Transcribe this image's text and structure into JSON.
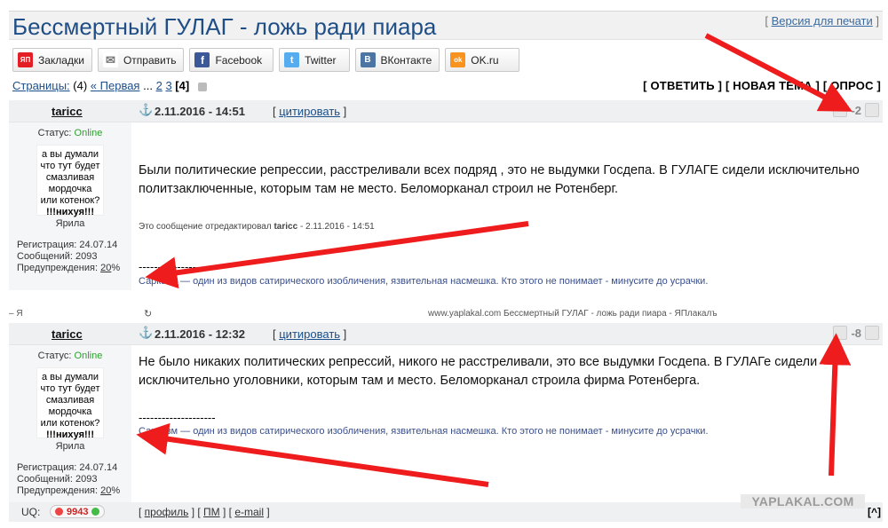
{
  "page": {
    "title": "Бессмертный ГУЛАГ - ложь ради пиара",
    "print_prefix": "[",
    "print_link": "Версия для печати",
    "print_suffix": "]"
  },
  "share": [
    {
      "label": "Закладки",
      "icon": "yandex-icon",
      "color": "#e31e24",
      "glyph": "ЯП"
    },
    {
      "label": "Отправить",
      "icon": "mail-icon",
      "color": "#999999",
      "glyph": "✉"
    },
    {
      "label": "Facebook",
      "icon": "facebook-icon",
      "color": "#3b5998",
      "glyph": "f"
    },
    {
      "label": "Twitter",
      "icon": "twitter-icon",
      "color": "#55acee",
      "glyph": "t"
    },
    {
      "label": "ВКонтакте",
      "icon": "vk-icon",
      "color": "#4c75a3",
      "glyph": "В"
    },
    {
      "label": "OK.ru",
      "icon": "odnoklassniki-icon",
      "color": "#f7931e",
      "glyph": "ok"
    }
  ],
  "pagination": {
    "label": "Страницы:",
    "count": "(4)",
    "first": "« Первая",
    "ellipsis": "...",
    "p2": "2",
    "p3": "3",
    "current": "[4]"
  },
  "actions": {
    "reply": "[ ОТВЕТИТЬ ]",
    "new_topic": "[ НОВАЯ ТЕМА ]",
    "poll": "[ ОПРОС ]"
  },
  "post1": {
    "username": "taricc",
    "date": "2.11.2016 - 14:51",
    "quote": "цитировать",
    "rating": "-2",
    "status_label": "Статус:",
    "status_value": "Online",
    "avatar_lines": [
      "а вы думали",
      "что тут будет",
      "смазливая",
      "мордочка",
      "или котенок?",
      "!!!нихуя!!!"
    ],
    "avatar_caption": "Ярила",
    "reg": "Регистрация: 24.07.14",
    "posts": "Сообщений: 2093",
    "warn_label": "Предупреждения:",
    "warn_value": "20",
    "warn_unit": "%",
    "text": "Были политические репрессии, расстреливали всех подряд , это не выдумки Госдепа. В ГУЛАГЕ сидели исключительно политзаключенные, которым там не место. Беломорканал строил не Ротенберг.",
    "edited_prefix": "Это сообщение отредактировал",
    "edited_user": "taricc",
    "edited_date": "- 2.11.2016 - 14:51",
    "dashes": "--------------------",
    "signature": "Сарказм — один из видов сатирического изобличения, язвительная насмешка. Кто этого не понимает - минусите до усрачки."
  },
  "browser": {
    "left": "–   Я",
    "reload": "↻",
    "url": "www.yaplakal.com  Бессмертный ГУЛАГ - ложь ради пиара - ЯПлакалъ"
  },
  "post2": {
    "username": "taricc",
    "date": "2.11.2016 - 12:32",
    "quote": "цитировать",
    "rating": "-8",
    "status_label": "Статус:",
    "status_value": "Online",
    "avatar_lines": [
      "а вы думали",
      "что тут будет",
      "смазливая",
      "мордочка",
      "или котенок?",
      "!!!нихуя!!!"
    ],
    "avatar_caption": "Ярила",
    "reg": "Регистрация: 24.07.14",
    "posts": "Сообщений: 2093",
    "warn_label": "Предупреждения:",
    "warn_value": "20",
    "warn_unit": "%",
    "text": "Не было никаких политических репрессий, никого не расстреливали, это все выдумки Госдепа. В ГУЛАГе сидели исключительно уголовники, которым там и место. Беломорканал строила фирма Ротенберга.",
    "dashes": "--------------------",
    "signature": "Сарка́зм — один из видов сатирического изобличения, язвительная насмешка. Кто этого не понимает - минусите до усрачки.",
    "uq_label": "UQ:",
    "uq_value": "9943",
    "profile_links": [
      "профиль",
      "ПМ",
      "e-mail"
    ],
    "up": "[^]"
  },
  "watermark": "YAPLAKAL.COM",
  "colors": {
    "accent": "#1f4e86",
    "arrow": "#ee1c1c",
    "online": "#2da02d"
  }
}
